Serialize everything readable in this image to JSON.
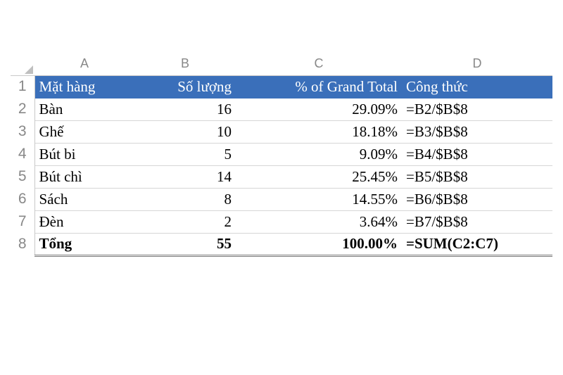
{
  "columns": [
    "A",
    "B",
    "C",
    "D"
  ],
  "row_numbers": [
    "1",
    "2",
    "3",
    "4",
    "5",
    "6",
    "7",
    "8"
  ],
  "header": {
    "A": "Mặt hàng",
    "B": "Số lượng",
    "C": "% of Grand Total",
    "D": "Công thức"
  },
  "rows": [
    {
      "A": "Bàn",
      "B": "16",
      "C": "29.09%",
      "D": "=B2/$B$8"
    },
    {
      "A": "Ghế",
      "B": "10",
      "C": "18.18%",
      "D": "=B3/$B$8"
    },
    {
      "A": "Bút bi",
      "B": "5",
      "C": "9.09%",
      "D": "=B4/$B$8"
    },
    {
      "A": "Bút chì",
      "B": "14",
      "C": "25.45%",
      "D": "=B5/$B$8"
    },
    {
      "A": "Sách",
      "B": "8",
      "C": "14.55%",
      "D": "=B6/$B$8"
    },
    {
      "A": "Đèn",
      "B": "2",
      "C": "3.64%",
      "D": "=B7/$B$8"
    }
  ],
  "total": {
    "A": "Tổng",
    "B": "55",
    "C": "100.00%",
    "D": "=SUM(C2:C7)"
  },
  "chart_data": {
    "type": "table",
    "title": "Mặt hàng / Số lượng / % of Grand Total",
    "categories": [
      "Bàn",
      "Ghế",
      "Bút bi",
      "Bút chì",
      "Sách",
      "Đèn"
    ],
    "series": [
      {
        "name": "Số lượng",
        "values": [
          16,
          10,
          5,
          14,
          8,
          2
        ]
      },
      {
        "name": "% of Grand Total",
        "values": [
          29.09,
          18.18,
          9.09,
          25.45,
          14.55,
          3.64
        ]
      }
    ],
    "total": {
      "Số lượng": 55,
      "% of Grand Total": 100.0
    }
  }
}
